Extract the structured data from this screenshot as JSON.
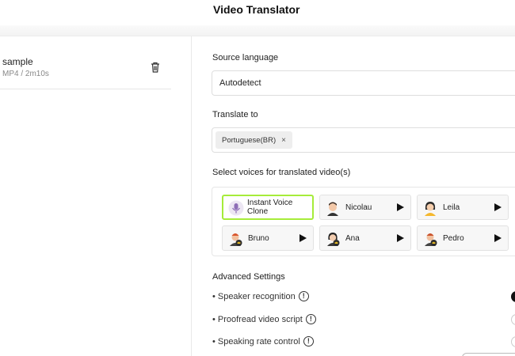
{
  "header": {
    "title": "Video Translator"
  },
  "file": {
    "name": "sample",
    "meta": "MP4 / 2m10s"
  },
  "source": {
    "label": "Source language",
    "value": "Autodetect"
  },
  "translate": {
    "label": "Translate to",
    "tag": "Portuguese(BR)",
    "tag_remove": "×"
  },
  "voices": {
    "label": "Select voices for translated video(s)",
    "items": [
      {
        "name": "Instant Voice Clone",
        "selected": true,
        "icon": "microphone-avatar-icon"
      },
      {
        "name": "Nicolau",
        "icon": "male-avatar-icon"
      },
      {
        "name": "Leila",
        "icon": "female-avatar-icon"
      },
      {
        "name": "Bruno",
        "icon": "male-avatar-crown-icon"
      },
      {
        "name": "Ana",
        "icon": "female-avatar-crown-icon"
      },
      {
        "name": "Pedro",
        "icon": "male-avatar-crown-icon"
      }
    ]
  },
  "advanced": {
    "title": "Advanced Settings",
    "settings": [
      {
        "label": "Speaker recognition",
        "info": "!",
        "enabled": true
      },
      {
        "label": "Proofread video script",
        "info": "!",
        "enabled": false
      },
      {
        "label": "Speaking rate control",
        "info": "!",
        "enabled": false
      }
    ]
  },
  "colors": {
    "selected_border": "#a6ec3a",
    "accent_dark": "#111111"
  }
}
